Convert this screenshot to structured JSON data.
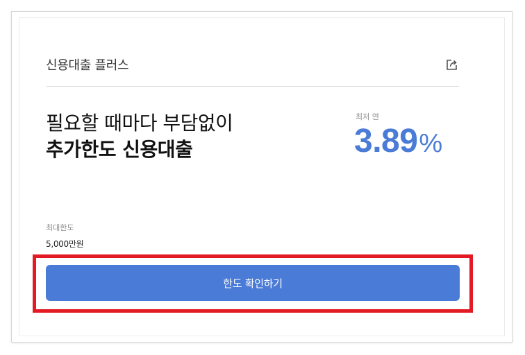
{
  "product": {
    "name": "신용대출 플러스"
  },
  "headline": {
    "line1": "필요할 때마다 부담없이",
    "line2": "추가한도 신용대출"
  },
  "rate": {
    "label": "최저 연",
    "value": "3.89",
    "unit": "%"
  },
  "limit": {
    "label": "최대한도",
    "value": "5,000만원"
  },
  "cta": {
    "label": "한도 확인하기"
  },
  "icons": {
    "share": "share-icon"
  },
  "colors": {
    "accent": "#4a7bd6",
    "highlight": "#e31a24",
    "divider": "#d9d9d9"
  }
}
